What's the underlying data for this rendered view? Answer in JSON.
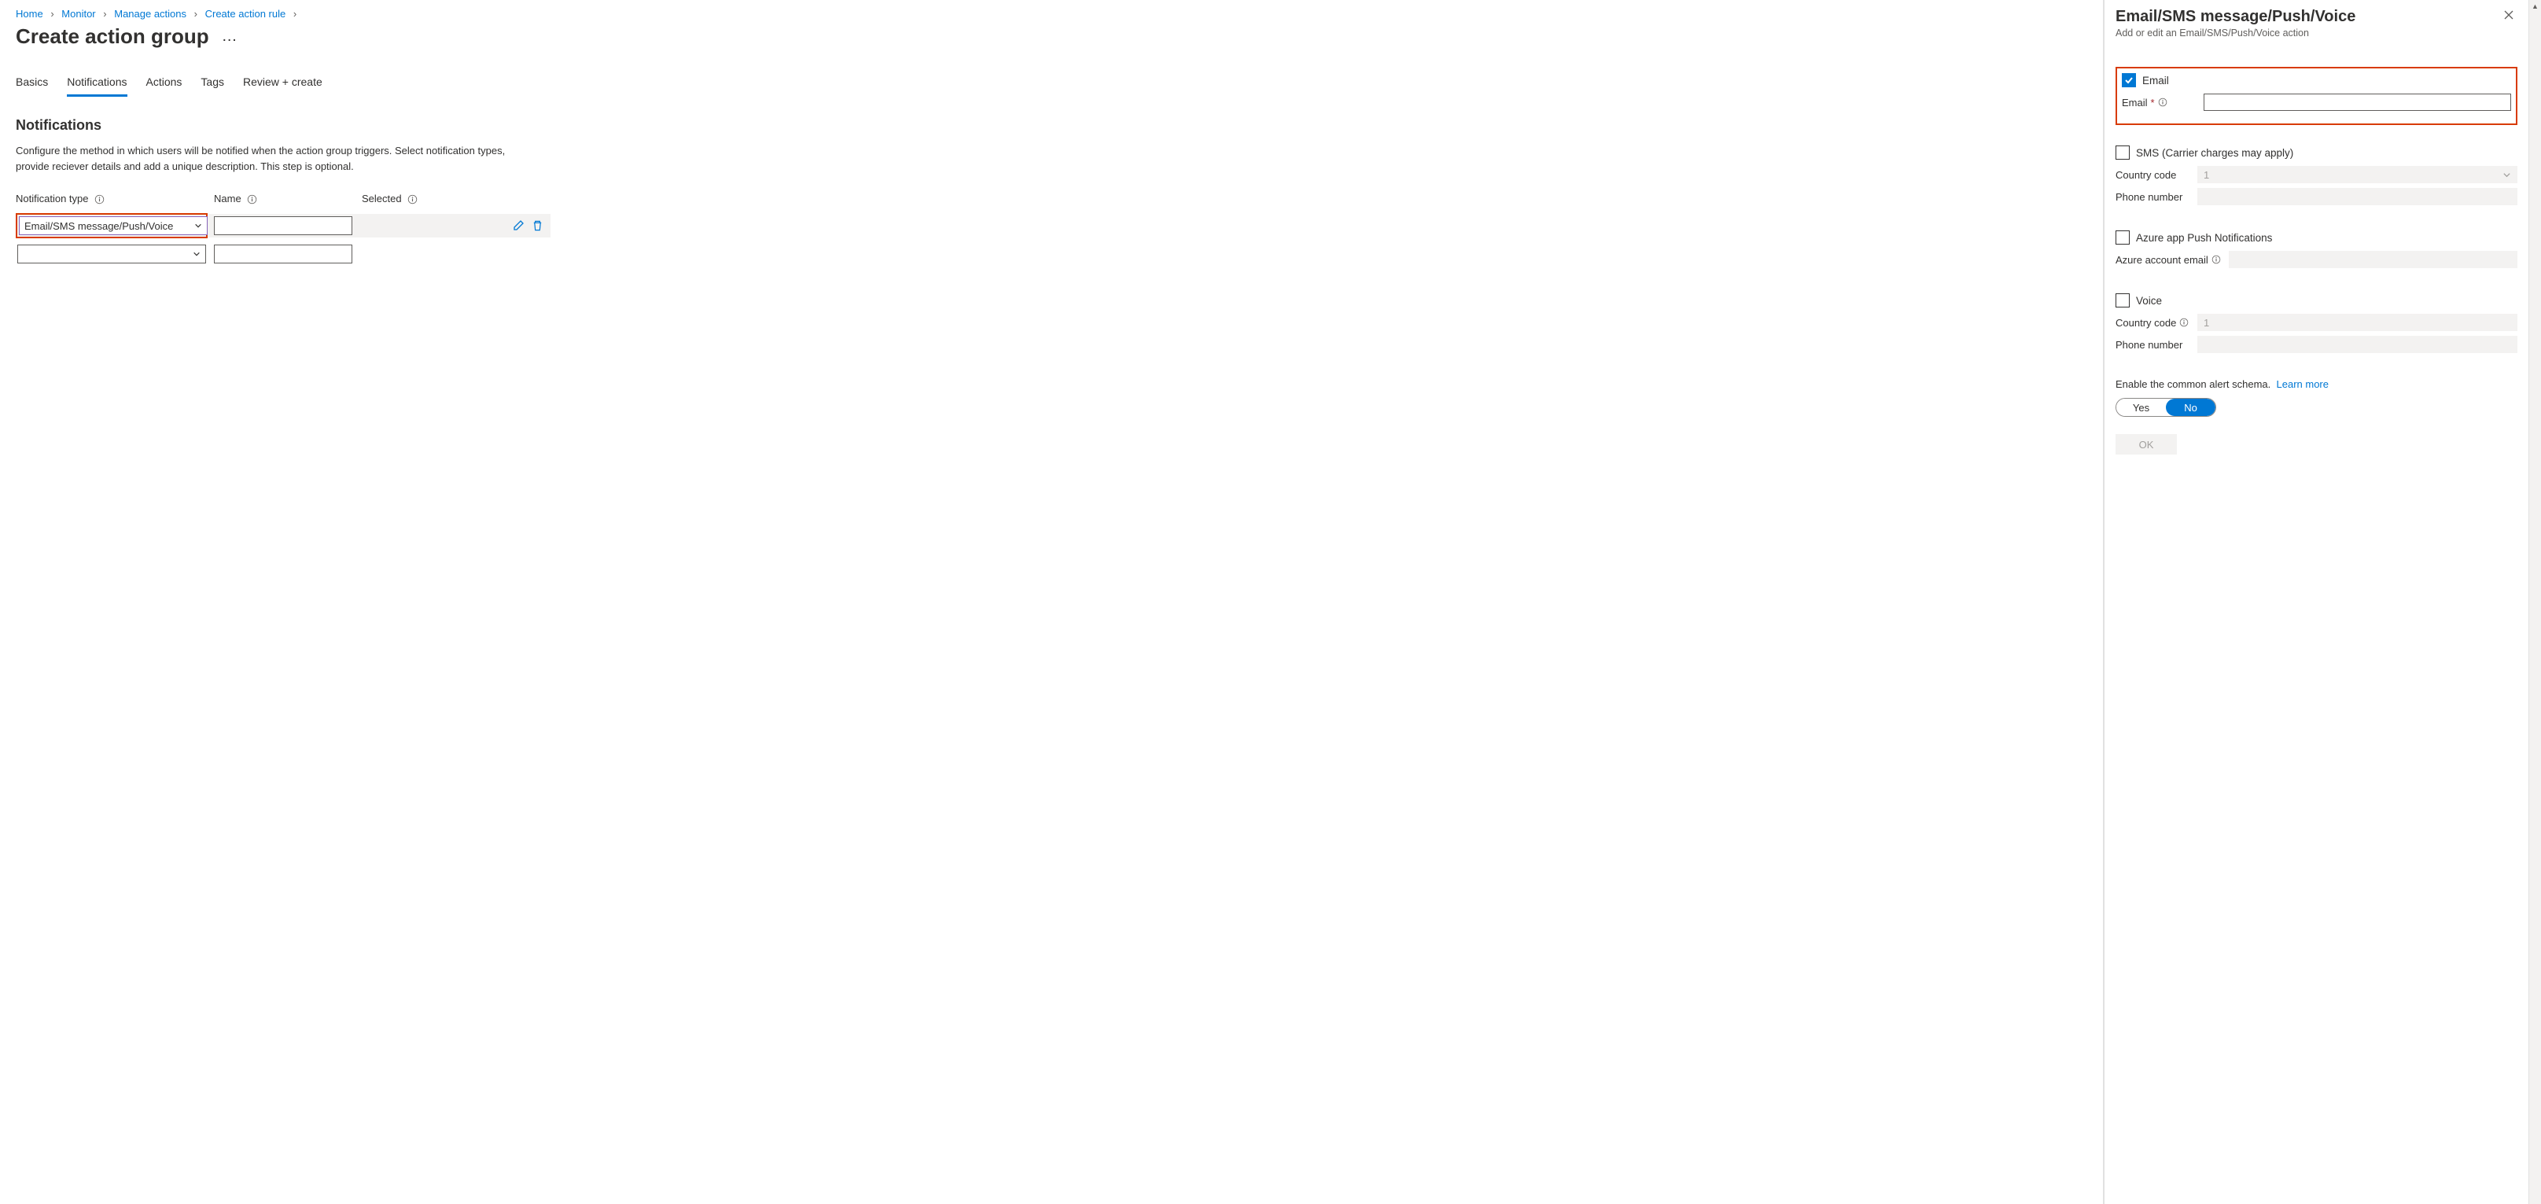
{
  "breadcrumbs": [
    "Home",
    "Monitor",
    "Manage actions",
    "Create action rule"
  ],
  "page_title": "Create action group",
  "more_glyph": "…",
  "tabs": [
    {
      "label": "Basics"
    },
    {
      "label": "Notifications",
      "active": true
    },
    {
      "label": "Actions"
    },
    {
      "label": "Tags"
    },
    {
      "label": "Review + create"
    }
  ],
  "section": {
    "heading": "Notifications",
    "description": "Configure the method in which users will be notified when the action group triggers. Select notification types, provide reciever details and add a unique description. This step is optional."
  },
  "table": {
    "headers": {
      "type": "Notification type",
      "name": "Name",
      "selected": "Selected"
    },
    "rows": [
      {
        "type": "Email/SMS message/Push/Voice",
        "name": "",
        "highlighted": true,
        "editable": true
      },
      {
        "type": "",
        "name": ""
      }
    ]
  },
  "panel": {
    "title": "Email/SMS message/Push/Voice",
    "subtitle": "Add or edit an Email/SMS/Push/Voice action",
    "email": {
      "label": "Email",
      "checked": true,
      "field_label": "Email",
      "value": ""
    },
    "sms": {
      "label": "SMS (Carrier charges may apply)",
      "checked": false,
      "country_label": "Country code",
      "country_value": "1",
      "phone_label": "Phone number",
      "phone_value": ""
    },
    "push": {
      "label": "Azure app Push Notifications",
      "checked": false,
      "field_label": "Azure account email",
      "value": ""
    },
    "voice": {
      "label": "Voice",
      "checked": false,
      "country_label": "Country code",
      "country_value": "1",
      "phone_label": "Phone number",
      "phone_value": ""
    },
    "schema": {
      "text": "Enable the common alert schema.",
      "learn_more": "Learn more",
      "yes": "Yes",
      "no": "No",
      "selected": "No"
    },
    "ok_label": "OK"
  }
}
